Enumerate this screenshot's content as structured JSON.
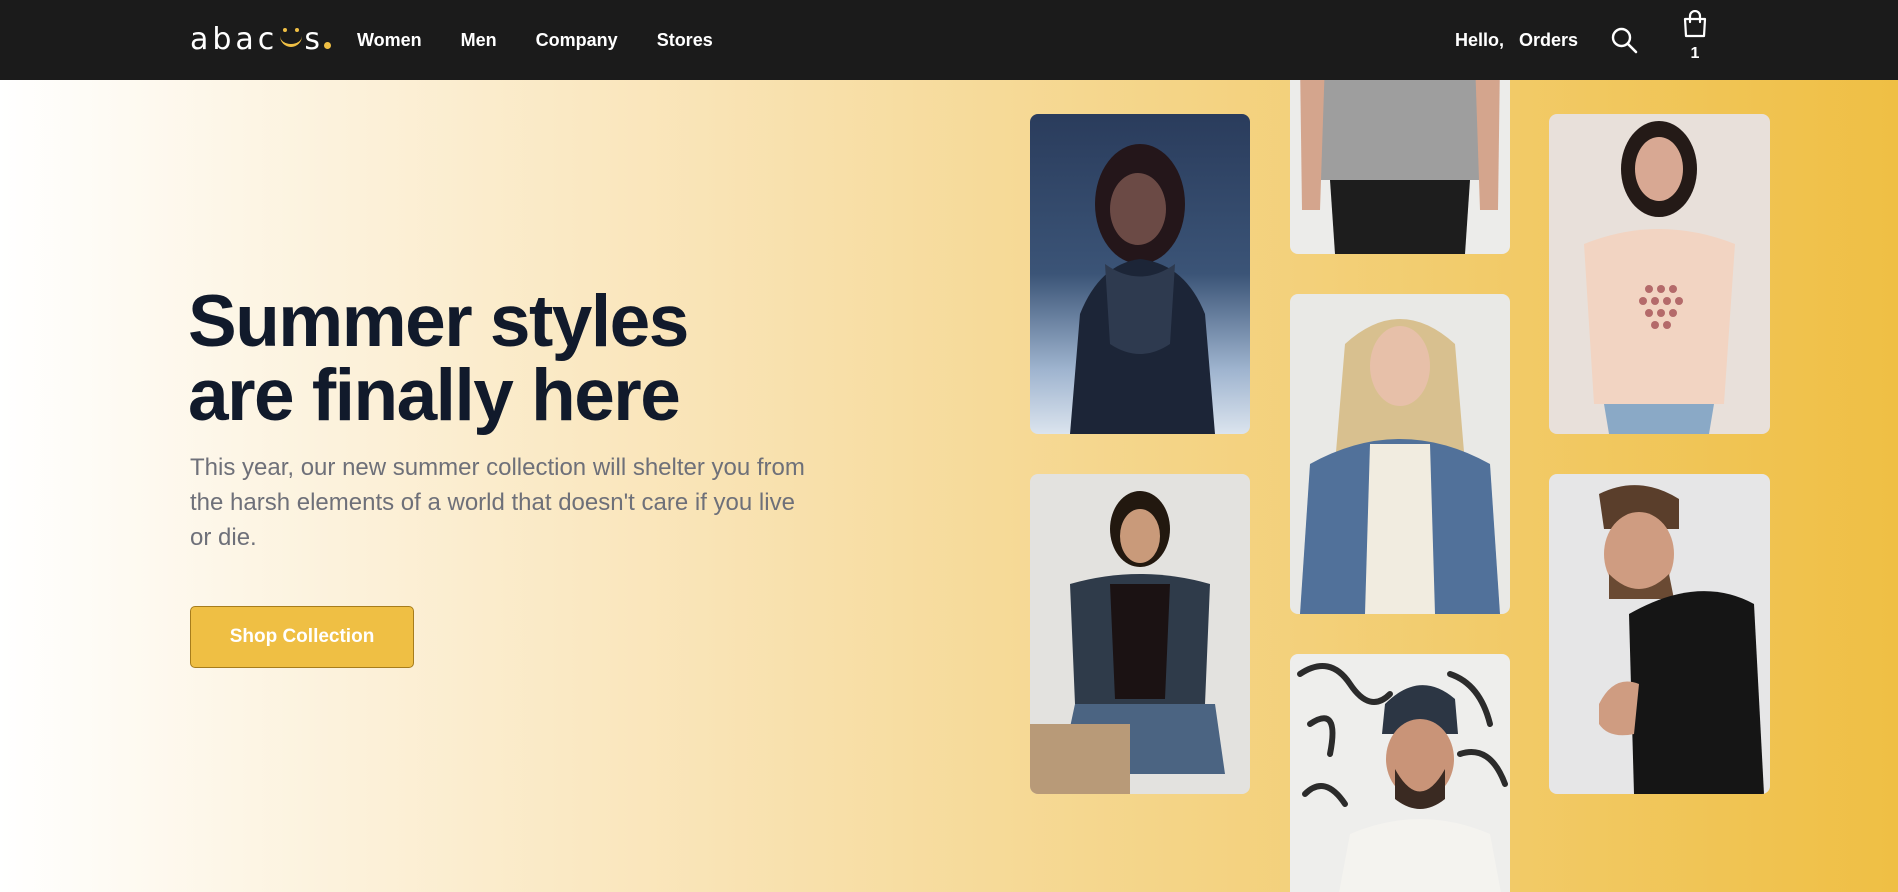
{
  "brand": {
    "logo_text_start": "abac",
    "logo_text_end": "s"
  },
  "nav": {
    "links": [
      "Women",
      "Men",
      "Company",
      "Stores"
    ],
    "greeting": "Hello,",
    "orders": "Orders",
    "cart_count": "1"
  },
  "hero": {
    "headline_line1": "Summer styles",
    "headline_line2": "are finally here",
    "subtext": "This year, our new summer collection will shelter you from the harsh elements of a world that doesn't care if you live or die.",
    "cta_label": "Shop Collection"
  },
  "colors": {
    "nav_background": "#1b1b1b",
    "accent": "#efbf44",
    "headline": "#111a2b",
    "body_text": "#6e7079"
  },
  "icons": [
    "search-icon",
    "shopping-bag-icon"
  ],
  "gallery": {
    "photos": [
      "woman-scarf-photo",
      "man-grey-tshirt-photo",
      "woman-pink-tee-photo",
      "woman-sitting-jacket-photo",
      "woman-denim-jacket-photo",
      "man-black-tee-photo",
      "man-beanie-photo"
    ]
  }
}
